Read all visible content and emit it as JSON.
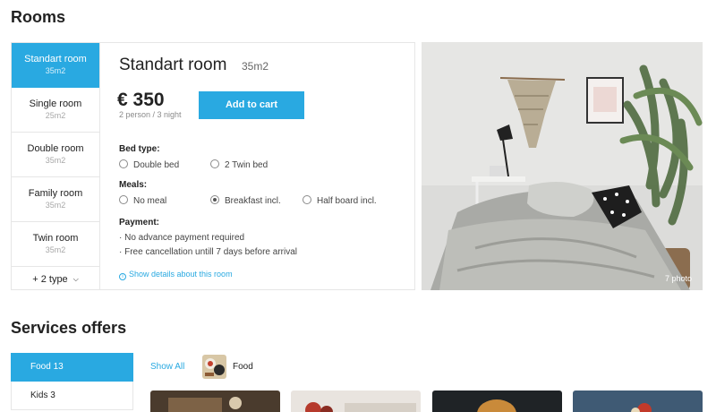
{
  "rooms_section": {
    "title": "Rooms",
    "room_types": [
      {
        "name": "Standart room",
        "size": "35m2",
        "active": true
      },
      {
        "name": "Single room",
        "size": "25m2",
        "active": false
      },
      {
        "name": "Double room",
        "size": "35m2",
        "active": false
      },
      {
        "name": "Family room",
        "size": "35m2",
        "active": false
      },
      {
        "name": "Twin room",
        "size": "35m2",
        "active": false
      }
    ],
    "more_types": "+ 2 type",
    "selected_room": {
      "title": "Standart room",
      "size": "35m2",
      "price": "€ 350",
      "price_note": "2 person / 3 night",
      "add_to_cart": "Add to cart",
      "bed_type": {
        "label": "Bed type:",
        "options": [
          "Double bed",
          "2 Twin bed"
        ],
        "selected": null
      },
      "meals": {
        "label": "Meals:",
        "options": [
          "No meal",
          "Breakfast incl.",
          "Half board incl."
        ],
        "selected": "Breakfast incl."
      },
      "payment": {
        "label": "Payment:",
        "lines": [
          "· No advance payment required",
          "· Free cancellation untill 7 days before arrival"
        ]
      },
      "details_link": "Show details about this room"
    },
    "photo": {
      "count_label": "7 photo"
    }
  },
  "services_section": {
    "title": "Services offers",
    "categories": [
      {
        "label": "Food 13",
        "active": true
      },
      {
        "label": "Kids 3",
        "active": false
      }
    ],
    "show_all": "Show All",
    "active_filter": "Food"
  },
  "colors": {
    "accent": "#29a9e1",
    "border": "#e6e6e6",
    "muted_text": "#a8a8a8"
  }
}
